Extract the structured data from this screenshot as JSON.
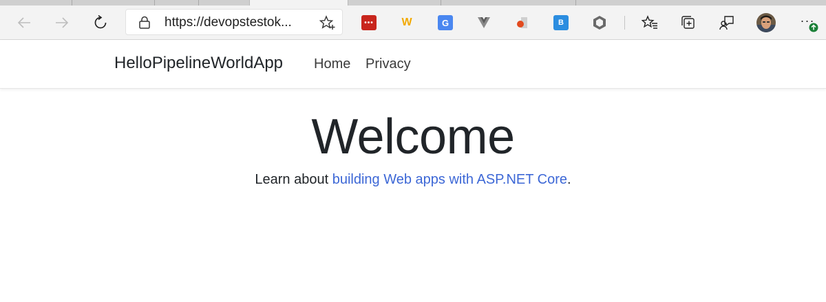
{
  "browser": {
    "address": "https://devopstestok...",
    "nav": {
      "back_icon": "arrow-left-icon",
      "forward_icon": "arrow-right-icon",
      "refresh_icon": "refresh-icon",
      "lock_icon": "lock-icon",
      "favorite_icon": "star-add-icon"
    },
    "extensions": [
      {
        "name": "lastpass-extension-icon",
        "glyph": "•••",
        "color": "#c8251c"
      },
      {
        "name": "w-extension-icon",
        "glyph": "W",
        "color": "#f2a900"
      },
      {
        "name": "google-translate-extension-icon",
        "glyph": "G",
        "color": "#4a87f0"
      },
      {
        "name": "vue-devtools-extension-icon",
        "glyph": "▼",
        "color": "#8a8a8a"
      },
      {
        "name": "office-extension-icon",
        "glyph": "◧",
        "color": "#e24a1e"
      },
      {
        "name": "bing-extension-icon",
        "glyph": "B",
        "color": "#2b8de0"
      },
      {
        "name": "hex-extension-icon",
        "glyph": "⬡",
        "color": "#6a6a6a"
      }
    ],
    "right_icons": [
      "favorites-list-icon",
      "collections-icon",
      "feedback-icon",
      "profile-avatar",
      "more-menu-icon"
    ],
    "more_label": "···"
  },
  "site": {
    "brand": "HelloPipelineWorldApp",
    "nav": {
      "home": "Home",
      "privacy": "Privacy"
    },
    "main": {
      "heading": "Welcome",
      "lead_prefix": "Learn about ",
      "lead_link": "building Web apps with ASP.NET Core",
      "lead_suffix": "."
    }
  },
  "colors": {
    "link": "#3c67d6",
    "text": "#212529",
    "toolbar_bg": "#f3f3f3"
  }
}
